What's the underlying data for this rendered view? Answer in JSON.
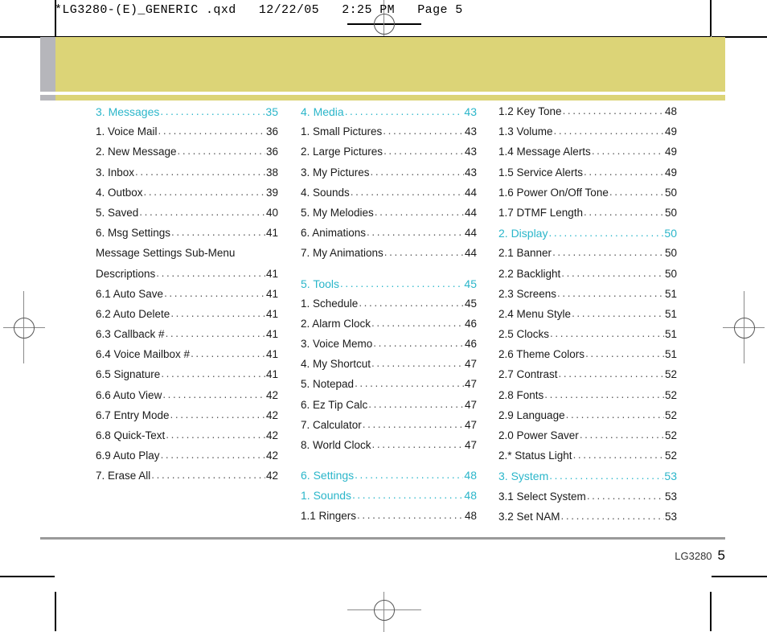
{
  "page_header": {
    "slug": "*LG3280-(E)_GENERIC .qxd   12/22/05   2:25 PM   Page 5"
  },
  "colors": {
    "accent_teal": "#2BB6CA",
    "banner_khaki": "#DCD477",
    "banner_tab_grey": "#B6B6BB",
    "rule_grey": "#9A9A9A",
    "body_text": "#1A1A1A"
  },
  "leader": "..........................................",
  "footer": {
    "model": "LG3280",
    "page_number": "5"
  },
  "toc": {
    "columns": [
      {
        "id": "column-1",
        "entries": [
          {
            "label": "3. Messages",
            "page": "35",
            "heading": true
          },
          {
            "label": "1. Voice Mail",
            "page": "36",
            "heading": false
          },
          {
            "label": "2. New Message",
            "page": "36",
            "heading": false
          },
          {
            "label": "3. Inbox",
            "page": "38",
            "heading": false
          },
          {
            "label": "4. Outbox",
            "page": "39",
            "heading": false
          },
          {
            "label": "5. Saved",
            "page": "40",
            "heading": false
          },
          {
            "label": "6. Msg Settings",
            "page": "41",
            "heading": false
          },
          {
            "label": "Message Settings Sub-Menu",
            "label2": "Descriptions",
            "page": "41",
            "heading": false,
            "wrap": true
          },
          {
            "label": "6.1 Auto Save",
            "page": "41",
            "heading": false
          },
          {
            "label": "6.2 Auto Delete",
            "page": "41",
            "heading": false
          },
          {
            "label": "6.3 Callback #",
            "page": "41",
            "heading": false
          },
          {
            "label": "6.4 Voice Mailbox #",
            "page": "41",
            "heading": false
          },
          {
            "label": "6.5 Signature",
            "page": "41",
            "heading": false
          },
          {
            "label": "6.6 Auto View",
            "page": "42",
            "heading": false
          },
          {
            "label": "6.7 Entry Mode",
            "page": "42",
            "heading": false
          },
          {
            "label": "6.8 Quick-Text",
            "page": "42",
            "heading": false
          },
          {
            "label": "6.9 Auto Play",
            "page": "42",
            "heading": false
          },
          {
            "label": "7. Erase All",
            "page": "42",
            "heading": false
          }
        ]
      },
      {
        "id": "column-2",
        "entries": [
          {
            "label": "4. Media",
            "page": "43",
            "heading": true
          },
          {
            "label": "1. Small Pictures",
            "page": "43",
            "heading": false
          },
          {
            "label": "2. Large Pictures",
            "page": "43",
            "heading": false
          },
          {
            "label": "3. My Pictures",
            "page": "43",
            "heading": false
          },
          {
            "label": "4. Sounds",
            "page": "44",
            "heading": false
          },
          {
            "label": "5. My Melodies",
            "page": "44",
            "heading": false
          },
          {
            "label": "6. Animations",
            "page": "44",
            "heading": false
          },
          {
            "label": "7. My Animations",
            "page": "44",
            "heading": false
          },
          {
            "label": "5. Tools",
            "page": "45",
            "heading": true,
            "gap": true
          },
          {
            "label": "1. Schedule",
            "page": "45",
            "heading": false
          },
          {
            "label": "2. Alarm Clock",
            "page": "46",
            "heading": false
          },
          {
            "label": "3. Voice Memo",
            "page": "46",
            "heading": false
          },
          {
            "label": "4. My Shortcut",
            "page": "47",
            "heading": false
          },
          {
            "label": "5. Notepad",
            "page": "47",
            "heading": false
          },
          {
            "label": "6. Ez Tip Calc",
            "page": "47",
            "heading": false
          },
          {
            "label": "7. Calculator",
            "page": "47",
            "heading": false
          },
          {
            "label": "8. World Clock",
            "page": "47",
            "heading": false
          },
          {
            "label": "6. Settings",
            "page": "48",
            "heading": true,
            "gap": true
          },
          {
            "label": "1. Sounds",
            "page": "48",
            "heading": true
          },
          {
            "label": "1.1 Ringers",
            "page": "48",
            "heading": false
          }
        ]
      },
      {
        "id": "column-3",
        "entries": [
          {
            "label": "1.2 Key Tone",
            "page": "48",
            "heading": false
          },
          {
            "label": "1.3 Volume",
            "page": "49",
            "heading": false
          },
          {
            "label": "1.4 Message Alerts",
            "page": "49",
            "heading": false
          },
          {
            "label": "1.5 Service Alerts",
            "page": "49",
            "heading": false
          },
          {
            "label": "1.6 Power On/Off Tone",
            "page": "50",
            "heading": false
          },
          {
            "label": "1.7 DTMF Length",
            "page": "50",
            "heading": false
          },
          {
            "label": "2. Display",
            "page": "50",
            "heading": true
          },
          {
            "label": "2.1 Banner",
            "page": "50",
            "heading": false
          },
          {
            "label": "2.2 Backlight",
            "page": "50",
            "heading": false
          },
          {
            "label": "2.3 Screens",
            "page": "51",
            "heading": false
          },
          {
            "label": "2.4 Menu Style",
            "page": "51",
            "heading": false
          },
          {
            "label": "2.5 Clocks",
            "page": "51",
            "heading": false
          },
          {
            "label": "2.6 Theme Colors",
            "page": "51",
            "heading": false
          },
          {
            "label": "2.7 Contrast",
            "page": "52",
            "heading": false
          },
          {
            "label": "2.8 Fonts",
            "page": "52",
            "heading": false
          },
          {
            "label": "2.9 Language",
            "page": "52",
            "heading": false
          },
          {
            "label": "2.0 Power Saver",
            "page": "52",
            "heading": false
          },
          {
            "label": "2.* Status Light",
            "page": "52",
            "heading": false
          },
          {
            "label": "3. System",
            "page": "53",
            "heading": true
          },
          {
            "label": "3.1 Select System",
            "page": "53",
            "heading": false
          },
          {
            "label": "3.2 Set NAM",
            "page": "53",
            "heading": false
          }
        ]
      }
    ]
  }
}
